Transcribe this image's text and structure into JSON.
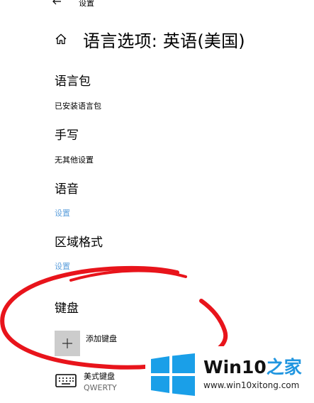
{
  "header": {
    "window_title": "设置",
    "page_title": "语言选项: 英语(美国)"
  },
  "sections": {
    "language_pack": {
      "title": "语言包",
      "status": "已安装语言包"
    },
    "handwriting": {
      "title": "手写",
      "status": "无其他设置"
    },
    "speech": {
      "title": "语音",
      "link": "设置"
    },
    "regional_format": {
      "title": "区域格式",
      "link": "设置"
    },
    "keyboard": {
      "title": "键盘",
      "add_label": "添加键盘",
      "items": [
        {
          "name": "美式键盘",
          "layout": "QWERTY"
        }
      ]
    }
  },
  "watermark": {
    "name_prefix": "Win10",
    "name_suffix": "之家",
    "url": "www.win10xitong.com"
  },
  "icons": {
    "back": "back-arrow-icon",
    "home": "home-icon",
    "add": "plus-icon",
    "keyboard": "keyboard-icon",
    "logo": "windows-logo-icon"
  },
  "colors": {
    "link": "#5ea0dc",
    "annotation": "#e8141b",
    "add_button_bg": "#cccccc",
    "logo": "#1a9fe8",
    "watermark_accent": "#2196e0"
  }
}
